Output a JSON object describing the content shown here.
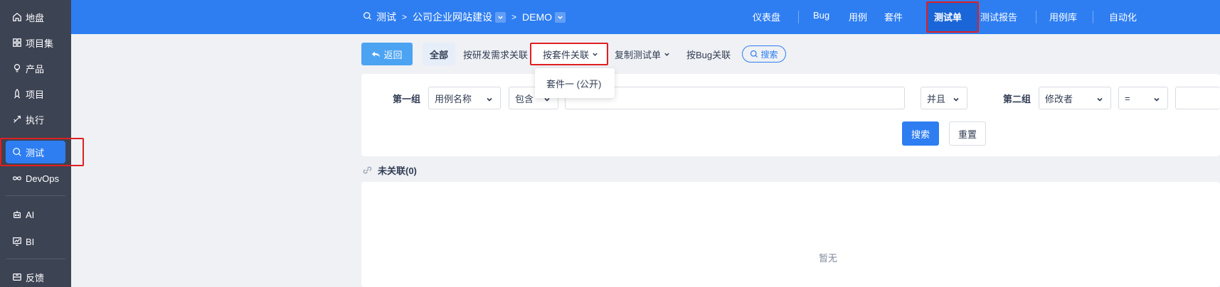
{
  "sidebar": {
    "items": [
      {
        "label": "地盘",
        "icon": "home-icon"
      },
      {
        "label": "项目集",
        "icon": "grid-icon"
      },
      {
        "label": "产品",
        "icon": "bulb-icon"
      },
      {
        "label": "项目",
        "icon": "rocket-icon"
      },
      {
        "label": "执行",
        "icon": "run-icon"
      },
      {
        "label": "测试",
        "icon": "test-icon",
        "active": true
      },
      {
        "label": "DevOps",
        "icon": "infinity-icon"
      },
      {
        "label": "AI",
        "icon": "robot-icon"
      },
      {
        "label": "BI",
        "icon": "chart-icon"
      },
      {
        "label": "反馈",
        "icon": "feedback-icon"
      }
    ]
  },
  "breadcrumb": {
    "items": [
      "测试",
      "公司企业网站建设",
      "DEMO"
    ]
  },
  "topnav": {
    "items": [
      "仪表盘",
      "Bug",
      "用例",
      "套件",
      "测试单",
      "测试报告",
      "用例库",
      "自动化"
    ],
    "active": "测试单"
  },
  "toolbar": {
    "back": "返回",
    "tabs": [
      "全部",
      "按研发需求关联",
      "按套件关联",
      "复制测试单",
      "按Bug关联"
    ],
    "search": "搜索"
  },
  "dropdown": {
    "items": [
      "套件一 (公开)"
    ]
  },
  "search_form": {
    "group1_label": "第一组",
    "group1_field": "用例名称",
    "group1_operator": "包含",
    "group1_value": "",
    "logic": "并且",
    "group2_label": "第二组",
    "group2_field": "修改者",
    "group2_operator": "=",
    "group2_value": "",
    "search_button": "搜索",
    "reset_button": "重置"
  },
  "unlinked": {
    "title": "未关联(0)",
    "empty_text": "暂无"
  },
  "colors": {
    "primary": "#2e7ef2",
    "sidebar_bg": "#3c4353",
    "highlight_border": "#e02020"
  }
}
